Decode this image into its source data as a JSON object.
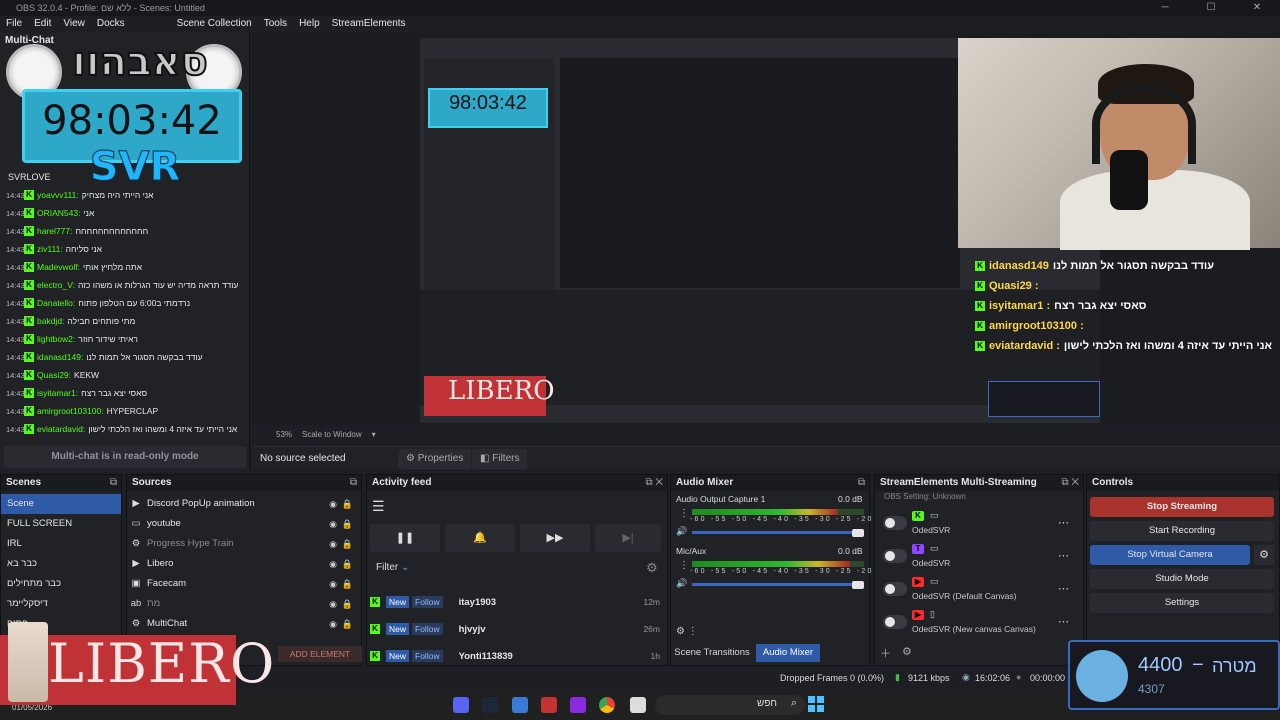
{
  "window": {
    "title": "OBS 32.0.4 - Profile: ללא שם - Scenes: Untitled",
    "controls": [
      "─",
      "☐",
      "✕"
    ]
  },
  "menu": [
    "File",
    "Edit",
    "View",
    "Docks",
    "Scene Collection",
    "Tools",
    "Help",
    "StreamElements"
  ],
  "chat_dock": {
    "title": "Multi-Chat",
    "clock": "98:03:42",
    "svr": "SVR",
    "logo_text": "סאבהוו",
    "partial_row": "SVRLOVE",
    "readonly": "Multi-chat is in read-only mode",
    "messages": [
      {
        "time": "14:43",
        "user": "yoavvv111:",
        "msg": "אני הייתי היה מצחיק"
      },
      {
        "time": "14:43",
        "user": "ORIAN543:",
        "msg": "אני"
      },
      {
        "time": "14:43",
        "user": "harel777:",
        "msg": "חחחחחחחחחחחחח"
      },
      {
        "time": "14:43",
        "user": "ziv111:",
        "msg": "אני סליחה"
      },
      {
        "time": "14:43",
        "user": "Madevwolf:",
        "msg": "אתה מלחיץ אותי"
      },
      {
        "time": "14:43",
        "user": "electro_V:",
        "msg": "עודד תראה מדיה יש עוד הגרלות או משהו כזה"
      },
      {
        "time": "14:43",
        "user": "Danatello:",
        "msg": "נרדמתי ב6:00 עם הטלפון פתוח"
      },
      {
        "time": "14:43",
        "user": "bakdjd:",
        "msg": "מתי פותחים חבילה"
      },
      {
        "time": "14:43",
        "user": "lightbow2:",
        "msg": "ראיתי שידור חוזר"
      },
      {
        "time": "14:43",
        "user": "idanasd149:",
        "msg": "עודד בבקשה תסגור אל תמות לנו"
      },
      {
        "time": "14:43",
        "user": "Quasi29:",
        "msg": "KEKW"
      },
      {
        "time": "14:43",
        "user": "isyitamar1:",
        "msg": "סאסי יצא גבר רצח"
      },
      {
        "time": "14:43",
        "user": "amirgroot103100:",
        "msg": "HYPERCLAP"
      },
      {
        "time": "14:43",
        "user": "eviatardavid:",
        "msg": "אני הייתי עד איזה 4 ומשהו ואז הלכתי לישון"
      }
    ]
  },
  "overlay_chat": [
    {
      "user": "idanasd149",
      "msg": "עודד בבקשה תסגור אל תמות לנו"
    },
    {
      "user": "Quasi29 :",
      "msg": ""
    },
    {
      "user": "isyitamar1 :",
      "msg": "סאסי יצא גבר רצח"
    },
    {
      "user": "amirgroot103100 :",
      "msg": ""
    },
    {
      "user": "eviatardavid :",
      "msg": "אני הייתי עד איזה 4 ומשהו ואז הלכתי לישון"
    }
  ],
  "preview": {
    "zoom": "53%",
    "scale_mode": "Scale to Window",
    "no_source": "No source selected",
    "properties": "Properties",
    "filters": "Filters"
  },
  "scenes": {
    "title": "Scenes",
    "items": [
      "Scene",
      "FULL SCREEN",
      "IRL",
      "כבר בא",
      "כבר מתחילים",
      "דיסקליימר",
      "פתיח"
    ]
  },
  "sources": {
    "title": "Sources",
    "items": [
      {
        "icon": "play",
        "label": "Discord PopUp animation",
        "dim": false
      },
      {
        "icon": "window",
        "label": "youtube",
        "dim": false
      },
      {
        "icon": "gear",
        "label": "Progress Hype Train",
        "dim": true
      },
      {
        "icon": "play",
        "label": "Libero",
        "dim": false
      },
      {
        "icon": "camera",
        "label": "Facecam",
        "dim": false
      },
      {
        "icon": "text",
        "label": "מת",
        "dim": true
      },
      {
        "icon": "gear",
        "label": "MultiChat",
        "dim": false
      }
    ],
    "add_element": "ADD ELEMENT"
  },
  "activity": {
    "title": "Activity feed",
    "filter": "Filter",
    "rows": [
      {
        "badge": "New",
        "type": "Follow",
        "name": "itay1903",
        "age": "12m"
      },
      {
        "badge": "New",
        "type": "Follow",
        "name": "hjvyjv",
        "age": "26m"
      },
      {
        "badge": "New",
        "type": "Follow",
        "name": "Yonti113839",
        "age": "1h"
      }
    ]
  },
  "mixer": {
    "title": "Audio Mixer",
    "channels": [
      {
        "name": "Audio Output Capture 1",
        "db": "0.0 dB",
        "level": 0.85
      },
      {
        "name": "Mic/Aux",
        "db": "0.0 dB",
        "level": 0.92
      }
    ],
    "scale": "-60 -55 -50 -45 -40 -35 -30 -25 -20 -15 -10 -5 0",
    "tab_transitions": "Scene Transitions",
    "tab_mixer": "Audio Mixer"
  },
  "multistream": {
    "title": "StreamElements Multi-Streaming",
    "header_partial": "OBS Setting: Unknown",
    "rows": [
      {
        "platform": "K",
        "color": "#53fc18",
        "name": "OdedSVR"
      },
      {
        "platform": "T",
        "color": "#9146ff",
        "name": "OdedSVR"
      },
      {
        "platform": "▶",
        "color": "#ff2a2a",
        "name": "OdedSVR (Default Canvas)"
      },
      {
        "platform": "▶",
        "color": "#ff2a2a",
        "name": "OdedSVR (New canvas Canvas)"
      }
    ]
  },
  "controls": {
    "title": "Controls",
    "stop_streaming": "Stop Streaming",
    "start_recording": "Start Recording",
    "stop_virtual_camera": "Stop Virtual Camera",
    "studio_mode": "Studio Mode",
    "settings": "Settings"
  },
  "status": {
    "dropped": "Dropped Frames 0 (0.0%)",
    "bitrate": "9121 kbps",
    "stream_time": "16:02:06",
    "rec_time": "00:00:00"
  },
  "goal": {
    "value": "4400",
    "label": "מטרה",
    "sub": "4307"
  },
  "libero": "LIBERO",
  "taskbar": {
    "search": "חפש",
    "date": "01/05/2026"
  },
  "colors": {
    "accent": "#2f5aa8",
    "stop_streaming": "#a8322c",
    "kick": "#53fc18"
  }
}
